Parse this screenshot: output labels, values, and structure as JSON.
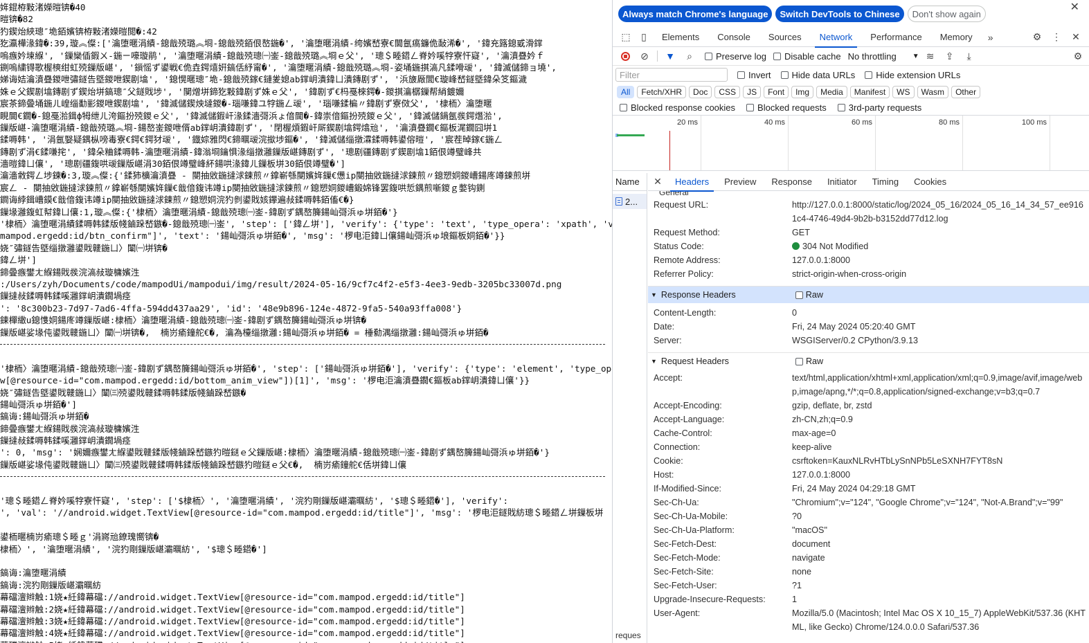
{
  "log": {
    "lines": [
      "姩錕栫敤渚嬫暟锛�40",
      "暟锛�82",
      "犳鍥炲綊璁″垝銆嬪锛栫敤渚嬫暟閲�:42",
      "犵瀛樺湪鍏�:39,璇︽儏:['瀹堕暱涓績-鎴戠殑璐︽埛-鎴戠殑銆佷嶅鍦�', '瀹堕暱涓績-绔嬪嵆寮€閫氬瘑鐮佹敮浠�', '鍏充簬鎴戜滑鐣",
      "嗚瘯妗堜緥', '鏁欒偛鍜ㄨ-鍦ㄧ嚎璇鹃', '瀹堕暱涓績-鎴戠殑璁㈠崟-鎴戠殑璐︽埛ｅ父', '璁＄畻鍣ㄥ脊妗嗘牸寮忓寲', '瀹濆疂妗ｆ",
      "鍘嗚繍锝歌楃樉绀虹殑鏁版嵁', '鎻愮ず鍙戦€佹垚鍔熺姸鎬佸紓甯�', '瀹堕暱涓績-鎴戠殑璐︽埛-姿埇鍦掑滈凡鍒嗗叆', '鍏滅儲鍗ョ墝',",
      "娣诲姞瀹濆疂鍐呭彇鐩告墍鍐呭鍥剧墖', '鎴愰暱璁″垝-鎴戠殑鎵€鏈夎媳ab鐣岄潰鍏ㄩ潰鏄剧ず', '浜旇厰閭€璇峰嵆鐩墍鍏朵笅鏂濊",
      "姝ｅ父鍥剧墖鏄剧ず鍥炲垪鎬璁″父鐩戝埗', '闃熷垪鍗犵敤鍏剧ず姝ｅ父', '鍏剧ず€杩戞棶鍔�-鍐掑瀹樼鏁帮綃鍍嬭",
      "宸茶鍗曡埇鍦ㄦ崲缁勫彨鍐呭鍥剧墖', '鍏滅儲鍥炴墶鍐�-瑙嗛鍏ユ牸鍦ㄥ叆', '瑙嗛鍒楄〃鍏剧ず寮傚父', '棣栭〉瀹堕暱",
      "睍閫€鐗�-鎴戞湁鍓ф牳绁ㄦ洿鏂扮殑鍐ｅ父', '鍏滅儲鍜屽湪鍒濇彁浜ょ偣閫�-鍏崇偣鏂扮殑鍐ｅ父', '鍏滅儲鍋氬彂鍔熸湁',",
      "鏁版嵁-瀹堕暱涓績-鎴戠殑璐︽埛-鍚嶅崟鍐呭偦ab鐣岄潰鍏剧ず', '閉楃煩鍜屽厛鍥剧墖鍔熻兘', '瀹濆疂鐗€鏂板浘鐗囧垪1",
      "鍒嗕韩', '涓氬嫛疑鍝枞嗙毒寮€鍔€鍔犲叆', '鐡婃雅閃€鍗曞叆浣撳埗鏂�', '鍏滅儲缁撴瀮鍒嗕韩鍙傛暟', '宸茬晫鎵€鍦ㄥ",
      "鏄剧ず涓€鍒嗛挓', '鍏朵粬鍒嗕韩-瀹堕暱涓績-鍏滃埛鑰惧湪缁撴灉鏁版嵁鏄剧ず', '璁剧疆鏄剧ず鍥剧墖1銆佷竴璧峰共",
      "濇暟鍏ㄩ儴', '璁剧疆鍑哄叆鏁版嵁涓30銆佷竴璧峰紑鍚哄湪鍏ㄦ鏁板垪30銆佷竴璧�']",
      "瀹濇敹鍔ㄥ埗鍊�:3,璇︽儏:{'鍒犻櫎瀹濆疂 - 閿抽敓鍦撻浗鍊煎〃鎿嶄綔閿嬪姩鏁€憊ip閿抽敓鍦撻浗鍊煎〃鎴愬姛鍐嶆鍚庝竴鍊煎垪",
      "宸ㄥ - 閿抽敓鍦撻浗鍊煎〃鎿嶄綔閿嬪姩鏁€戠偣鍑讳竴ip閿抽敓鍦撻浗鍊煎〃鎴愬姛鍐嶆鍛婂锋罢鍑哄悊鍝煎噺鍐ｇ嫳钩鍘",
      "鐧诲綍鍓嶆鏌€戠偣鍑讳竴ip閿抽敓鍦撻浗鍊煎〃鎴愬姛浣犳剼鍙戝姟鑻遍敊鍒嗕韩銆傗€�}",
      "鏁堟灉鍑虹幇鍏ㄩ儴:1,璇︽儏:{'棣栭〉瀹堕暱涓績-鎴戠殑璁㈠崟-鍏剧ず鍝嶅簲鍚屾彁浜ゅ垪銆�'}",
      "'棣栭〉瀹堕暱涓績鍒嗕韩鍒版帴鏀跺嵆鏃�-鎴戠殑璁㈠崟', 'step': ['鍏ㄥ垪'], 'verify': {'type': 'text', 'type_opera': 'xpath', 'val':",
      "mampod.ergedd:id/btn_confirm\"]', 'text': '鍚屾彁浜ゅ垪銆�', 'msg': '椤电洰鍏ㄩ儴鍚屾彁浜ゅ埌鏂板姛銆�'}}",
      "娆″彇鐩告墍缁撴灉鍙戝竷鍦ㄩ〉闈㈠垪锛�",
      "鍏ㄥ垪']",
      "鍗曡瘯鐢ㄤ緥鍚戝彂浣滈敊璇槦嬪泩",
      ":/Users/zyh/Documents/code/mampodUi/mampodui/img/result/2024-05-16/9cf7c4f2-e5f3-4ee3-9edb-3205bc33007d.png",
      "鏁撻敊鍒嗕韩鍒嗘灉鐣岄潰鐗堝痉",
      "': '8c300b23-7d97-7ad6-4ffa-594dd437aa29', 'id': '48e9b896-124e-4872-9fa5-540a93ffa008'}",
      "鍊樿繖u鎴愯姛鍚庝竴鏁版嵁:棣栭〉瀹堕暱涓績-鎴戠殑璁㈠崟-鍏剧ず鍝嶅簲鍚屾彁浜ゅ垪锛�",
      "鏁版嵁娑堟伅鍙戝竷鍦ㄩ〉闈㈠垪锛�,  楠岃瘉鐘舵€�, 瀹為檯缁撴灉:鍚屾彁浜ゅ垪銆� = 棰勬湡缁撴灉:鍚屾彁浜ゅ垪銆�",
      "__SEP__",
      "",
      "'棣栭〉瀹堕暱涓績-鎴戠殑璁㈠崟-鍏剧ず鍝嶅簲鍚屾彁浜ゅ垪銆�', 'step': ['鍚屾彁浜ゅ垪銆�'], 'verify': {'type': 'element', 'type_opera':",
      "w[@resource-id=\"com.mampod.ergedd:id/bottom_anim_view\"])[1]', 'msg': '椤电洰瀹濆疂鐗€鏂板ab鐣岄潰鍏ㄩ儴'}}",
      "娆″彇鐩告墍鍙戝竷鍦ㄩ〉闈㈢殑鍙戝竷鍒嗕韩鍒版帴鏀跺嵆鏃�",
      "鍚屾彁浜ゅ垪銆�']",
      "鎬诲:鍚屾彁浜ゅ垪銆�",
      "鍗曡瘯鐢ㄤ緥鍚戝彂浣滈敊璇槦嬪泩",
      "鏁撻敊鍒嗕韩鍒嗘灉鐣岄潰鐗堝痉",
      "': 0, 'msg': '娴嬭瘯鐢ㄤ緥鍙戝竷鍒版帴鏀跺嵆鏃犳暟鎹ｅ父鏁版嵁:棣栭〉瀹堕暱涓績-鎴戠殑璁㈠崟-鍏剧ず鍝嶅簲鍚屾彁浜ゅ垪銆�'}",
      "鏁版嵁娑堟伅鍙戝竷鍦ㄩ〉闈㈢殑鍙戝竷鍒嗕韩鍒版帴鏀跺嵆鏃犳暟鎹ｅ父€�,  楠岃瘉鐘舵€佸垪鍏ㄩ儴",
      "__SEP__",
      "",
      "'璁＄畻鍣ㄥ脊妗嗘牸寮忓寲', 'step': ['$棣栭〉', '瀹堕暱涓績', '浣犳剛鏁版嵁灞曞紡', '$璁＄畻鍣�'], 'verify':",
      "', 'val': '//android.widget.TextView[@resource-id=\"com.mampod.ergedd:id/title\"]', 'msg': '椤电洰鐩戝紡璁＄畻鍣ㄥ垪鏁板垪",
      "",
      "鍙栭暱楠岃瘉璁＄畻ｇ'涓嶈兘鐐瑰嚮锛�",
      "棣栭〉', '瀹堕暱涓績', '浣犳剛鏁版嵁灞曞紡', '$璁＄畻鍣�']",
      "",
      "鎬诲:瀹堕暱涓績",
      "鎬诲:浣犳剛鏁版嵁灞曞紡",
      "幕礑澶辫触:1娆★紝鍏幕礑://android.widget.TextView[@resource-id=\"com.mampod.ergedd:id/title\"]",
      "幕礑澶辫触:2娆★紝鍏幕礑://android.widget.TextView[@resource-id=\"com.mampod.ergedd:id/title\"]",
      "幕礑澶辫触:3娆★紝鍏幕礑://android.widget.TextView[@resource-id=\"com.mampod.ergedd:id/title\"]",
      "幕礑澶辫触:4娆★紝鍏幕礑://android.widget.TextView[@resource-id=\"com.mampod.ergedd:id/title\"]",
      "幕礑澶辫触:5娆★紝鍏幕礑://android.widget.TextView[@resource-id=\"com.mampod.ergedd:id/title\"]",
      "鏁撻敊鍒嗕韩鍒嗘灉鐣岄潰"
    ]
  },
  "devtools": {
    "infobar": {
      "match_language": "Always match Chrome's language",
      "switch_chinese": "Switch DevTools to Chinese",
      "dont_show": "Don't show again"
    },
    "tabs": [
      "Elements",
      "Console",
      "Sources",
      "Network",
      "Performance",
      "Memory"
    ],
    "active_tab": "Network",
    "toolbar": {
      "preserve_log": "Preserve log",
      "disable_cache": "Disable cache",
      "throttling": "No throttling"
    },
    "filter": {
      "placeholder": "Filter",
      "invert": "Invert",
      "hide_data_urls": "Hide data URLs",
      "hide_extension_urls": "Hide extension URLs"
    },
    "types": [
      "All",
      "Fetch/XHR",
      "Doc",
      "CSS",
      "JS",
      "Font",
      "Img",
      "Media",
      "Manifest",
      "WS",
      "Wasm",
      "Other"
    ],
    "blocked": {
      "cookies": "Blocked response cookies",
      "requests": "Blocked requests",
      "third_party": "3rd-party requests"
    },
    "timeline_ticks": [
      "20 ms",
      "40 ms",
      "60 ms",
      "80 ms",
      "100 ms"
    ],
    "name_column": {
      "header": "Name",
      "row": "2...",
      "footer": "reques"
    },
    "detail_tabs": [
      "Headers",
      "Preview",
      "Response",
      "Initiator",
      "Timing",
      "Cookies"
    ],
    "active_detail_tab": "Headers",
    "general_partial": "General",
    "general": [
      {
        "k": "Request URL:",
        "v": "http://127.0.0.1:8000/static/log/2024_05_16/2024_05_16_14_34_57_ee9161c4-4746-49d4-9b2b-b3152dd77d12.log"
      },
      {
        "k": "Request Method:",
        "v": "GET"
      },
      {
        "k": "Status Code:",
        "v": "304 Not Modified"
      },
      {
        "k": "Remote Address:",
        "v": "127.0.0.1:8000"
      },
      {
        "k": "Referrer Policy:",
        "v": "strict-origin-when-cross-origin"
      }
    ],
    "response_headers": {
      "title": "Response Headers",
      "raw": "Raw",
      "items": [
        {
          "k": "Content-Length:",
          "v": "0"
        },
        {
          "k": "Date:",
          "v": "Fri, 24 May 2024 05:20:40 GMT"
        },
        {
          "k": "Server:",
          "v": "WSGIServer/0.2 CPython/3.9.13"
        }
      ]
    },
    "request_headers": {
      "title": "Request Headers",
      "raw": "Raw",
      "items": [
        {
          "k": "Accept:",
          "v": "text/html,application/xhtml+xml,application/xml;q=0.9,image/avif,image/webp,image/apng,*/*;q=0.8,application/signed-exchange;v=b3;q=0.7"
        },
        {
          "k": "Accept-Encoding:",
          "v": "gzip, deflate, br, zstd"
        },
        {
          "k": "Accept-Language:",
          "v": "zh-CN,zh;q=0.9"
        },
        {
          "k": "Cache-Control:",
          "v": "max-age=0"
        },
        {
          "k": "Connection:",
          "v": "keep-alive"
        },
        {
          "k": "Cookie:",
          "v": "csrftoken=KauxNLRvHTbLySnNPb5LeSXNH7FYT8sN"
        },
        {
          "k": "Host:",
          "v": "127.0.0.1:8000"
        },
        {
          "k": "If-Modified-Since:",
          "v": "Fri, 24 May 2024 04:29:18 GMT"
        },
        {
          "k": "Sec-Ch-Ua:",
          "v": "\"Chromium\";v=\"124\", \"Google Chrome\";v=\"124\", \"Not-A.Brand\";v=\"99\""
        },
        {
          "k": "Sec-Ch-Ua-Mobile:",
          "v": "?0"
        },
        {
          "k": "Sec-Ch-Ua-Platform:",
          "v": "\"macOS\""
        },
        {
          "k": "Sec-Fetch-Dest:",
          "v": "document"
        },
        {
          "k": "Sec-Fetch-Mode:",
          "v": "navigate"
        },
        {
          "k": "Sec-Fetch-Site:",
          "v": "none"
        },
        {
          "k": "Sec-Fetch-User:",
          "v": "?1"
        },
        {
          "k": "Upgrade-Insecure-Requests:",
          "v": "1"
        },
        {
          "k": "User-Agent:",
          "v": "Mozilla/5.0 (Macintosh; Intel Mac OS X 10_15_7) AppleWebKit/537.36 (KHTML, like Gecko) Chrome/124.0.0.0 Safari/537.36"
        }
      ]
    },
    "colors": {
      "accent": "#0b57d0",
      "status_ok": "#1e8e3e",
      "record": "#d93025"
    }
  }
}
